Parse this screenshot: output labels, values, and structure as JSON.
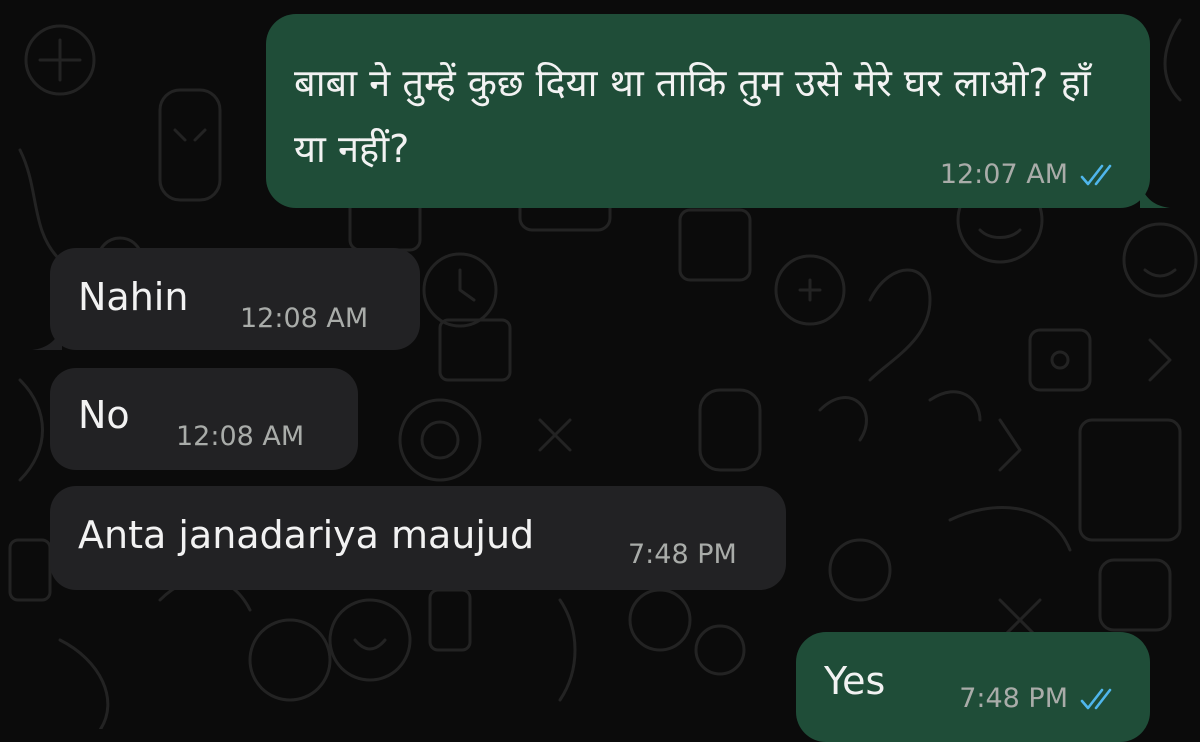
{
  "chat": {
    "messages": [
      {
        "direction": "outgoing",
        "text": "बाबा ने तुम्हें कुछ दिया था ताकि तुम उसे मेरे घर लाओ? हाँ या नहीं?",
        "time": "12:07 AM",
        "status": "read"
      },
      {
        "direction": "incoming",
        "text": "Nahin",
        "time": "12:08 AM"
      },
      {
        "direction": "incoming",
        "text": "No",
        "time": "12:08 AM"
      },
      {
        "direction": "incoming",
        "text": "Anta janadariya maujud",
        "time": "7:48 PM"
      },
      {
        "direction": "outgoing",
        "text": "Yes",
        "time": "7:48 PM",
        "status": "read"
      }
    ]
  },
  "colors": {
    "background": "#0b0b0b",
    "incoming_bubble": "#222224",
    "outgoing_bubble": "#1f4d38",
    "read_ticks": "#4fb6ec",
    "timestamp": "#a9aca9"
  },
  "icons": {
    "read_receipt": "double-check-icon"
  }
}
